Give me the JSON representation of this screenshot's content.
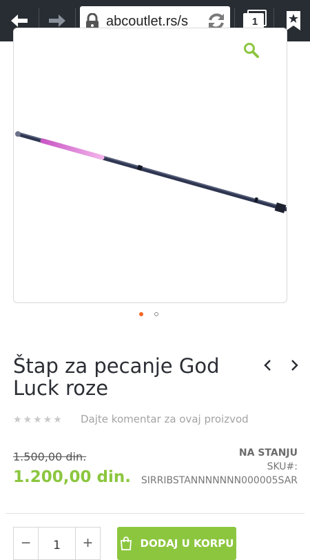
{
  "browser": {
    "url": "abcoutlet.rs/s",
    "tab_count": "1",
    "icons": [
      "back-arrow-icon",
      "forward-arrow-icon",
      "lock-icon",
      "reload-icon",
      "tabs-icon",
      "bookmark-star-icon"
    ]
  },
  "product": {
    "title": "Štap za pecanje God Luck roze",
    "review_link": "Dajte komentar za ovaj proizvod",
    "rating_stars": 0,
    "rating_max": 5,
    "old_price": "1.500,00 din.",
    "price": "1.200,00 din.",
    "stock_status": "NA STANJU",
    "sku_label": "SKU#:",
    "sku": "SIRRIBSTANNNNNNN000005SAR",
    "gallery": {
      "active_index": 0,
      "count": 2
    }
  },
  "cart": {
    "quantity": "1",
    "minus_label": "−",
    "plus_label": "+",
    "add_label": "DODAJ U KORPU"
  },
  "colors": {
    "toolbar": "#282d33",
    "accent_green": "#8cc63f",
    "active_dot": "#f26522",
    "title_text": "#2b2e34"
  }
}
